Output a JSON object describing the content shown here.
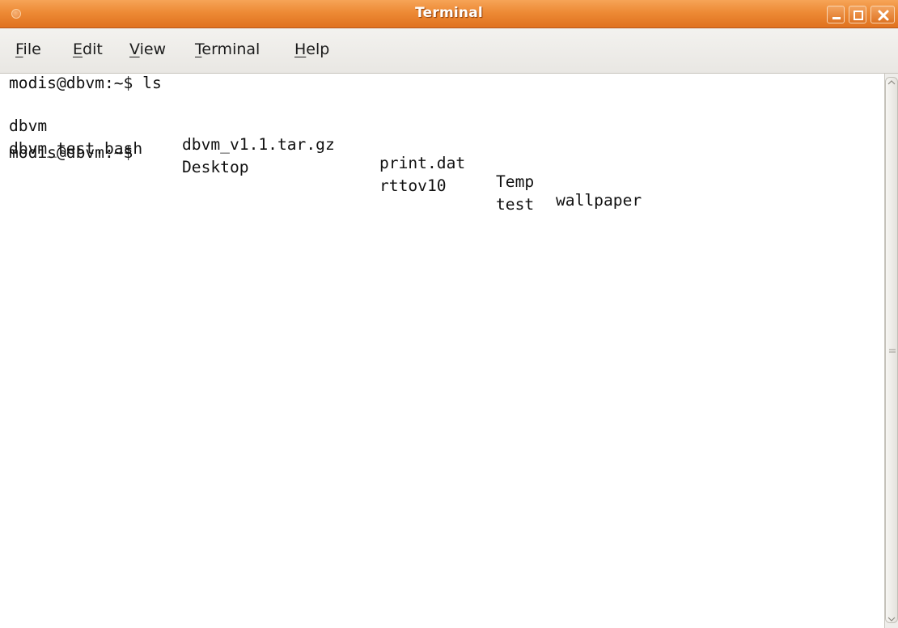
{
  "window": {
    "title": "Terminal",
    "buttons": [
      "minimize-icon",
      "maximize-icon",
      "close-icon"
    ]
  },
  "menubar": {
    "items": [
      {
        "mnemonic": "F",
        "rest": "ile"
      },
      {
        "mnemonic": "E",
        "rest": "dit"
      },
      {
        "mnemonic": "V",
        "rest": "iew"
      },
      {
        "mnemonic": "T",
        "rest": "erminal"
      },
      {
        "mnemonic": "H",
        "rest": "elp"
      }
    ]
  },
  "terminal": {
    "prompt": "modis@dbvm:~$",
    "command": " ls",
    "ls_rows": [
      [
        "dbvm",
        "dbvm_v1.1.tar.gz",
        "print.dat",
        "Temp",
        "wallpaper"
      ],
      [
        "dbvm_test.bash",
        "Desktop",
        "rttov10",
        "test",
        ""
      ]
    ],
    "current_prompt": "modis@dbvm:~$"
  },
  "colors": {
    "titlebar": "#ed8a35",
    "menubar": "#efeeeb",
    "terminal_bg": "#ffffff",
    "terminal_fg": "#111111"
  }
}
